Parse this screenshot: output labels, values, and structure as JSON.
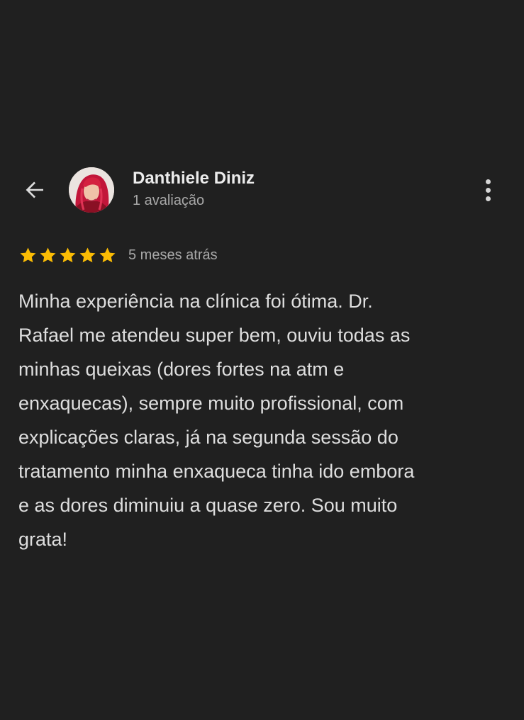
{
  "header": {
    "back_icon": "arrow-left-icon",
    "more_icon": "more-vertical-icon"
  },
  "reviewer": {
    "name": "Danthiele Diniz",
    "reviews_count": "1 avaliação",
    "avatar": "user-avatar-photo"
  },
  "review": {
    "rating": 5,
    "rating_max": 5,
    "date": "5 meses atrás",
    "text_lines": [
      "Minha experiência na clínica foi ótima. Dr.",
      "Rafael me atendeu super bem, ouviu todas as",
      "minhas queixas (dores fortes na atm e",
      "enxaquecas), sempre muito profissional, com",
      "explicações claras, já na segunda sessão do",
      "tratamento minha enxaqueca tinha ido embora",
      "e as dores diminuiu a quase zero. Sou muito",
      "grata!"
    ]
  },
  "colors": {
    "background": "#202020",
    "star": "#fbbc04",
    "text_primary": "#ececec",
    "text_secondary": "#a8a8a8"
  }
}
